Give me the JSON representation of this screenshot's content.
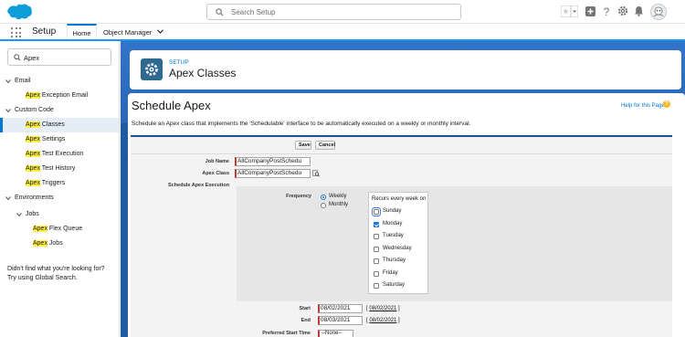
{
  "header": {
    "search_placeholder": "Search Setup",
    "icons": [
      "favorites-star-icon",
      "favorites-dropdown-icon",
      "global-actions-icon",
      "help-icon",
      "setup-gear-icon",
      "notifications-bell-icon",
      "avatar"
    ]
  },
  "nav": {
    "app_name": "Setup",
    "tabs": [
      {
        "label": "Home"
      },
      {
        "label": "Object Manager"
      }
    ]
  },
  "sidebar": {
    "quickfind_value": "Apex",
    "items": [
      {
        "label": "Email"
      },
      {
        "hl": "Apex",
        "rest": " Exception Email"
      },
      {
        "label": "Custom Code"
      },
      {
        "hl": "Apex",
        "rest": " Classes"
      },
      {
        "hl": "Apex",
        "rest": " Settings"
      },
      {
        "hl": "Apex",
        "rest": " Test Execution"
      },
      {
        "hl": "Apex",
        "rest": " Test History"
      },
      {
        "hl": "Apex",
        "rest": " Triggers"
      },
      {
        "label": "Environments"
      },
      {
        "label": "Jobs"
      },
      {
        "hl": "Apex",
        "rest": " Flex Queue"
      },
      {
        "hl": "Apex",
        "rest": " Jobs"
      }
    ],
    "didnt_find_line1": "Didn't find what you're looking for?",
    "didnt_find_line2": "Try using Global Search."
  },
  "page_header": {
    "eyebrow": "SETUP",
    "title": "Apex Classes"
  },
  "page": {
    "title": "Schedule Apex",
    "help_link": "Help for this Page",
    "help_icon": "?",
    "description": "Schedule an Apex class that implements the 'Schedulable' interface to be automatically executed on a weekly or monthly interval."
  },
  "form": {
    "save_label": "Save",
    "cancel_label": "Cancel",
    "job_name_label": "Job Name",
    "job_name_value": "AllCompanyPostSchedu",
    "apex_class_label": "Apex Class",
    "apex_class_value": "AllCompanyPostSchedu",
    "execution_label": "Schedule Apex Execution",
    "frequency_label": "Frequency",
    "frequency_options": [
      "Weekly",
      "Monthly"
    ],
    "frequency_selected": "Weekly",
    "recurs_label": "Recurs every week on",
    "days": [
      {
        "label": "Sunday",
        "checked": false
      },
      {
        "label": "Monday",
        "checked": true
      },
      {
        "label": "Tuesday",
        "checked": false
      },
      {
        "label": "Wednesday",
        "checked": false
      },
      {
        "label": "Thursday",
        "checked": false
      },
      {
        "label": "Friday",
        "checked": false
      },
      {
        "label": "Saturday",
        "checked": false
      }
    ],
    "start_label": "Start",
    "start_value": "08/02/2021",
    "start_link": "08/02/2021",
    "end_label": "End",
    "end_value": "08/03/2021",
    "end_link": "08/02/2021",
    "preferred_label": "Preferred Start Time",
    "preferred_value": "--None--"
  },
  "colors": {
    "brand_blue": "#0176d3",
    "main_background": "#2a68b6",
    "required_red": "#c23934",
    "search_highlight": "#fff03f"
  }
}
